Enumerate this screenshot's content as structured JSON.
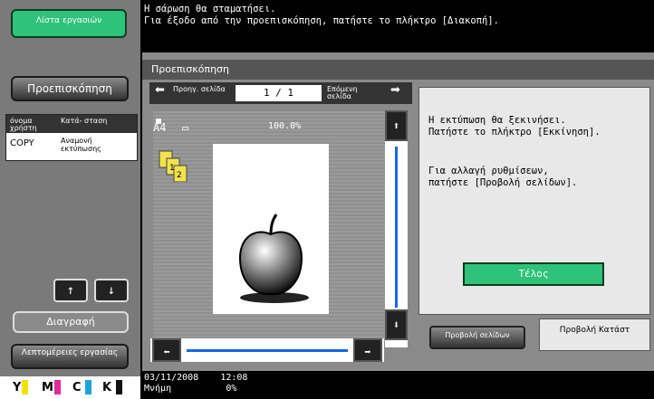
{
  "sidebar": {
    "job_list_label": "Λίστα εργασιών",
    "preview_label": "Προεπισκόπηση",
    "table": {
      "col_user": "όνομα χρήστη",
      "col_status": "Κατά- σταση",
      "row_user": "COPY",
      "row_status": "Αναμονή εκτύπωσης"
    },
    "up_arrow": "↑",
    "down_arrow": "↓",
    "delete_label": "Διαγραφή",
    "details_label": "Λεπτομέρειες εργασίας"
  },
  "toner": {
    "labels": [
      "Y",
      "M",
      "C",
      "K"
    ],
    "colors": [
      "#f2e200",
      "#e02a9a",
      "#19a3dd",
      "#111111"
    ]
  },
  "header": {
    "message_line1": "Η σάρωση θα σταματήσει.",
    "message_line2": "Για έξοδο από την προεπισκόπηση, πατήστε το πλήκτρο [Διακοπή]."
  },
  "window": {
    "title": "Προεπισκόπηση",
    "prev_page_label": "Προηγ. σελίδα",
    "next_page_label": "Επόμενη σελίδα",
    "page_indicator": "1 /    1",
    "paper": "A4",
    "zoom": "100.0%",
    "info_text_1": "Η εκτύπωση θα ξεκινήσει.\nΠατήστε το πλήκτρο [Εκκίνηση].",
    "info_text_2": "Για αλλαγή ρυθμίσεων,\nπατήστε [Προβολή σελίδων].",
    "finish_label": "Τέλος",
    "tab_pages_label": "Προβολή σελίδων",
    "tab_state_label": "Προβολή Κατάστ"
  },
  "footer": {
    "date": "03/11/2008",
    "time": "12:08",
    "memory_label": "Μνήμη",
    "memory_value": "0%"
  }
}
